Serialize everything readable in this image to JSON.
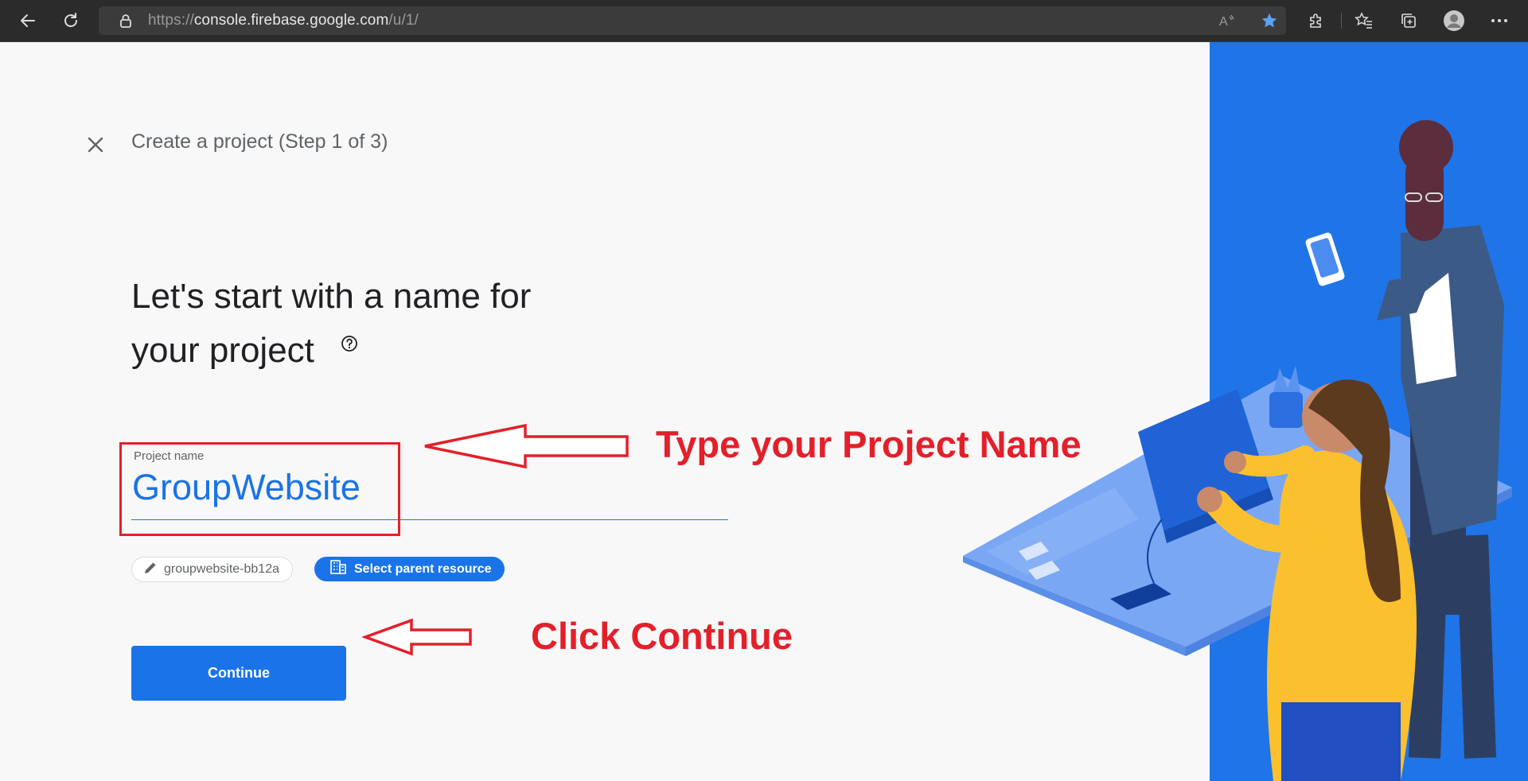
{
  "browser": {
    "url_prefix": "https://",
    "url_host": "console.firebase.google.com",
    "url_path": "/u/1/"
  },
  "page": {
    "step_title": "Create a project (Step 1 of 3)",
    "heading_line1": "Let's start with a name for",
    "heading_line2": "your project",
    "project_name_label": "Project name",
    "project_name_value": "GroupWebsite",
    "project_id": "groupwebsite-bb12a",
    "select_parent_label": "Select parent resource",
    "continue_label": "Continue"
  },
  "annotations": {
    "type_name": "Type your Project Name",
    "click_continue": "Click Continue",
    "color": "#e3202a"
  },
  "colors": {
    "accent": "#1a73e8",
    "illustration_bg": "#1f74e8"
  },
  "icons": {
    "back": "back-arrow-icon",
    "refresh": "refresh-icon",
    "lock": "lock-icon",
    "read_aloud": "read-aloud-icon",
    "favorite": "star-icon",
    "extensions": "puzzle-icon",
    "favorites_list": "favorites-icon",
    "collections": "collections-icon",
    "profile": "profile-icon",
    "more": "more-icon",
    "close": "close-icon",
    "help": "help-icon",
    "edit": "pencil-icon",
    "building": "building-icon"
  }
}
